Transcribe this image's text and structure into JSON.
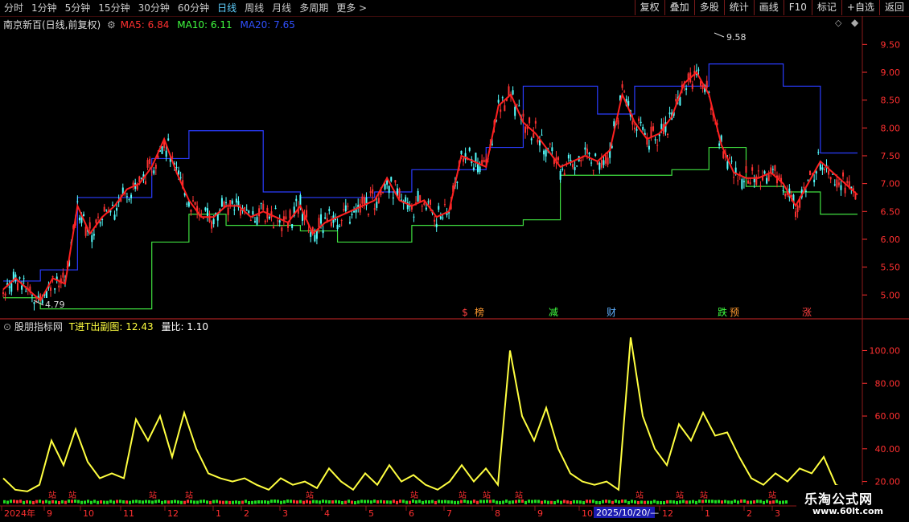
{
  "toolbar": {
    "periods": [
      "分时",
      "1分钟",
      "5分钟",
      "15分钟",
      "30分钟",
      "60分钟",
      "日线",
      "周线",
      "月线",
      "多周期",
      "更多"
    ],
    "active_period": "日线",
    "more_arrow": ">",
    "buttons": [
      "复权",
      "叠加",
      "多股",
      "统计",
      "画线",
      "F10",
      "标记",
      "+自选",
      "返回"
    ]
  },
  "main_panel": {
    "stock_title": "南京新百(日线,前复权)",
    "ma5": "MA5: 6.84",
    "ma10": "MA10: 6.11",
    "ma20": "MA20: 7.65",
    "high_label": "9.58",
    "low_label": "4.79",
    "price_ticks": [
      "9.50",
      "9.00",
      "8.50",
      "8.00",
      "7.50",
      "7.00",
      "6.50",
      "6.00",
      "5.50",
      "5.00"
    ],
    "event_markers": [
      {
        "text": "$",
        "color": "#ff4040"
      },
      {
        "text": "榜",
        "color": "#ff9a30"
      },
      {
        "text": "减",
        "color": "#40ff40"
      },
      {
        "text": "财",
        "color": "#5fb0ff"
      },
      {
        "text": "跌",
        "color": "#40ff40"
      },
      {
        "text": "预",
        "color": "#ff9a30"
      },
      {
        "text": "涨",
        "color": "#ff4040"
      }
    ]
  },
  "sub_panel": {
    "indicator_name": "股朋指标网",
    "series_label": "T进T出副图: 12.43",
    "ratio_label": "量比: 1.10",
    "ticks": [
      "100.00",
      "80.00",
      "60.00",
      "40.00",
      "20.00"
    ]
  },
  "time_axis": {
    "labels": [
      "2024年",
      "9",
      "10",
      "11",
      "12",
      "1",
      "2",
      "3",
      "4",
      "5",
      "6",
      "7",
      "8",
      "9",
      "10",
      "12",
      "1",
      "2",
      "3"
    ],
    "cursor_date": "2025/10/20/—"
  },
  "watermark": {
    "title": "乐淘公式网",
    "url": "www.60lt.com"
  },
  "colors": {
    "background": "#000000",
    "grid_red": "#8b1a1a",
    "candle_up": "#ff3232",
    "candle_down": "#54ffff",
    "ma_red": "#ff2020",
    "band_upper": "#2a3cff",
    "band_lower": "#40e040",
    "indicator_line": "#ffff40",
    "axis_text": "#ff3030"
  },
  "chart_data": [
    {
      "type": "line",
      "title": "南京新百(日线,前复权)",
      "ylim": [
        4.6,
        9.75
      ],
      "x_range": [
        "2024-08",
        "2026-03"
      ],
      "series": [
        {
          "name": "MA5",
          "values": [
            5.1,
            5.3,
            5.1,
            4.9,
            5.3,
            5.2,
            6.6,
            6.1,
            6.4,
            6.6,
            6.9,
            7.0,
            7.3,
            7.8,
            7.2,
            6.7,
            6.4,
            6.4,
            6.6,
            6.6,
            6.4,
            6.5,
            6.4,
            6.3,
            6.6,
            6.1,
            6.3,
            6.4,
            6.5,
            6.6,
            6.7,
            7.1,
            6.7,
            6.6,
            6.7,
            6.4,
            6.5,
            7.5,
            7.4,
            7.3,
            8.4,
            8.6,
            8.1,
            7.9,
            7.6,
            7.3,
            7.4,
            7.5,
            7.4,
            7.6,
            8.6,
            8.1,
            7.8,
            7.9,
            8.2,
            8.8,
            9.0,
            8.6,
            7.7,
            7.2,
            7.1,
            7.1,
            7.2,
            7.0,
            6.6,
            7.0,
            7.4,
            7.2,
            7.0,
            6.8
          ]
        }
      ],
      "bands": {
        "upper_start": 5.5,
        "lower_start": 5.05,
        "upper_peak": 9.58,
        "lower_min": 4.79
      }
    },
    {
      "type": "line",
      "title": "T进T出副图",
      "ylim": [
        10,
        112
      ],
      "series": [
        {
          "name": "T进T出副图",
          "values": [
            22,
            15,
            14,
            18,
            45,
            30,
            52,
            32,
            22,
            25,
            22,
            58,
            45,
            60,
            35,
            62,
            40,
            25,
            22,
            20,
            22,
            18,
            15,
            22,
            18,
            20,
            16,
            28,
            20,
            15,
            25,
            18,
            30,
            20,
            24,
            18,
            15,
            20,
            30,
            20,
            28,
            18,
            100,
            60,
            45,
            65,
            40,
            25,
            20,
            18,
            20,
            15,
            108,
            60,
            40,
            30,
            55,
            45,
            62,
            48,
            50,
            35,
            22,
            18,
            25,
            20,
            28,
            25,
            35,
            18,
            15
          ]
        }
      ]
    }
  ]
}
